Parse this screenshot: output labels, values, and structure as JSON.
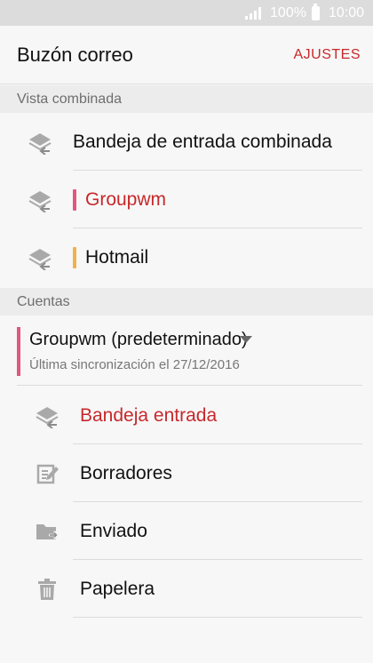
{
  "status_bar": {
    "battery": "100%",
    "time": "10:00"
  },
  "app_bar": {
    "title": "Buzón correo",
    "settings_label": "AJUSTES"
  },
  "combined_view": {
    "header": "Vista combinada",
    "items": [
      {
        "label": "Bandeja de entrada combinada",
        "icon": "mailbox-stack-icon"
      },
      {
        "label": "Groupwm",
        "icon": "mailbox-stack-icon",
        "accent": "#e2567f",
        "active": true
      },
      {
        "label": "Hotmail",
        "icon": "mailbox-stack-icon",
        "accent": "#f2b04b"
      }
    ]
  },
  "accounts": {
    "header": "Cuentas",
    "account_name": "Groupwm (predeterminado)",
    "last_sync": "Última sincronización el 27/12/2016",
    "folders": [
      {
        "label": "Bandeja entrada",
        "icon": "inbox-icon",
        "active": true
      },
      {
        "label": "Borradores",
        "icon": "drafts-icon"
      },
      {
        "label": "Enviado",
        "icon": "sent-folder-icon"
      },
      {
        "label": "Papelera",
        "icon": "trash-icon"
      }
    ]
  },
  "colors": {
    "accent_red": "#c7282b",
    "groupwm": "#e2567f",
    "hotmail": "#f2b04b"
  }
}
